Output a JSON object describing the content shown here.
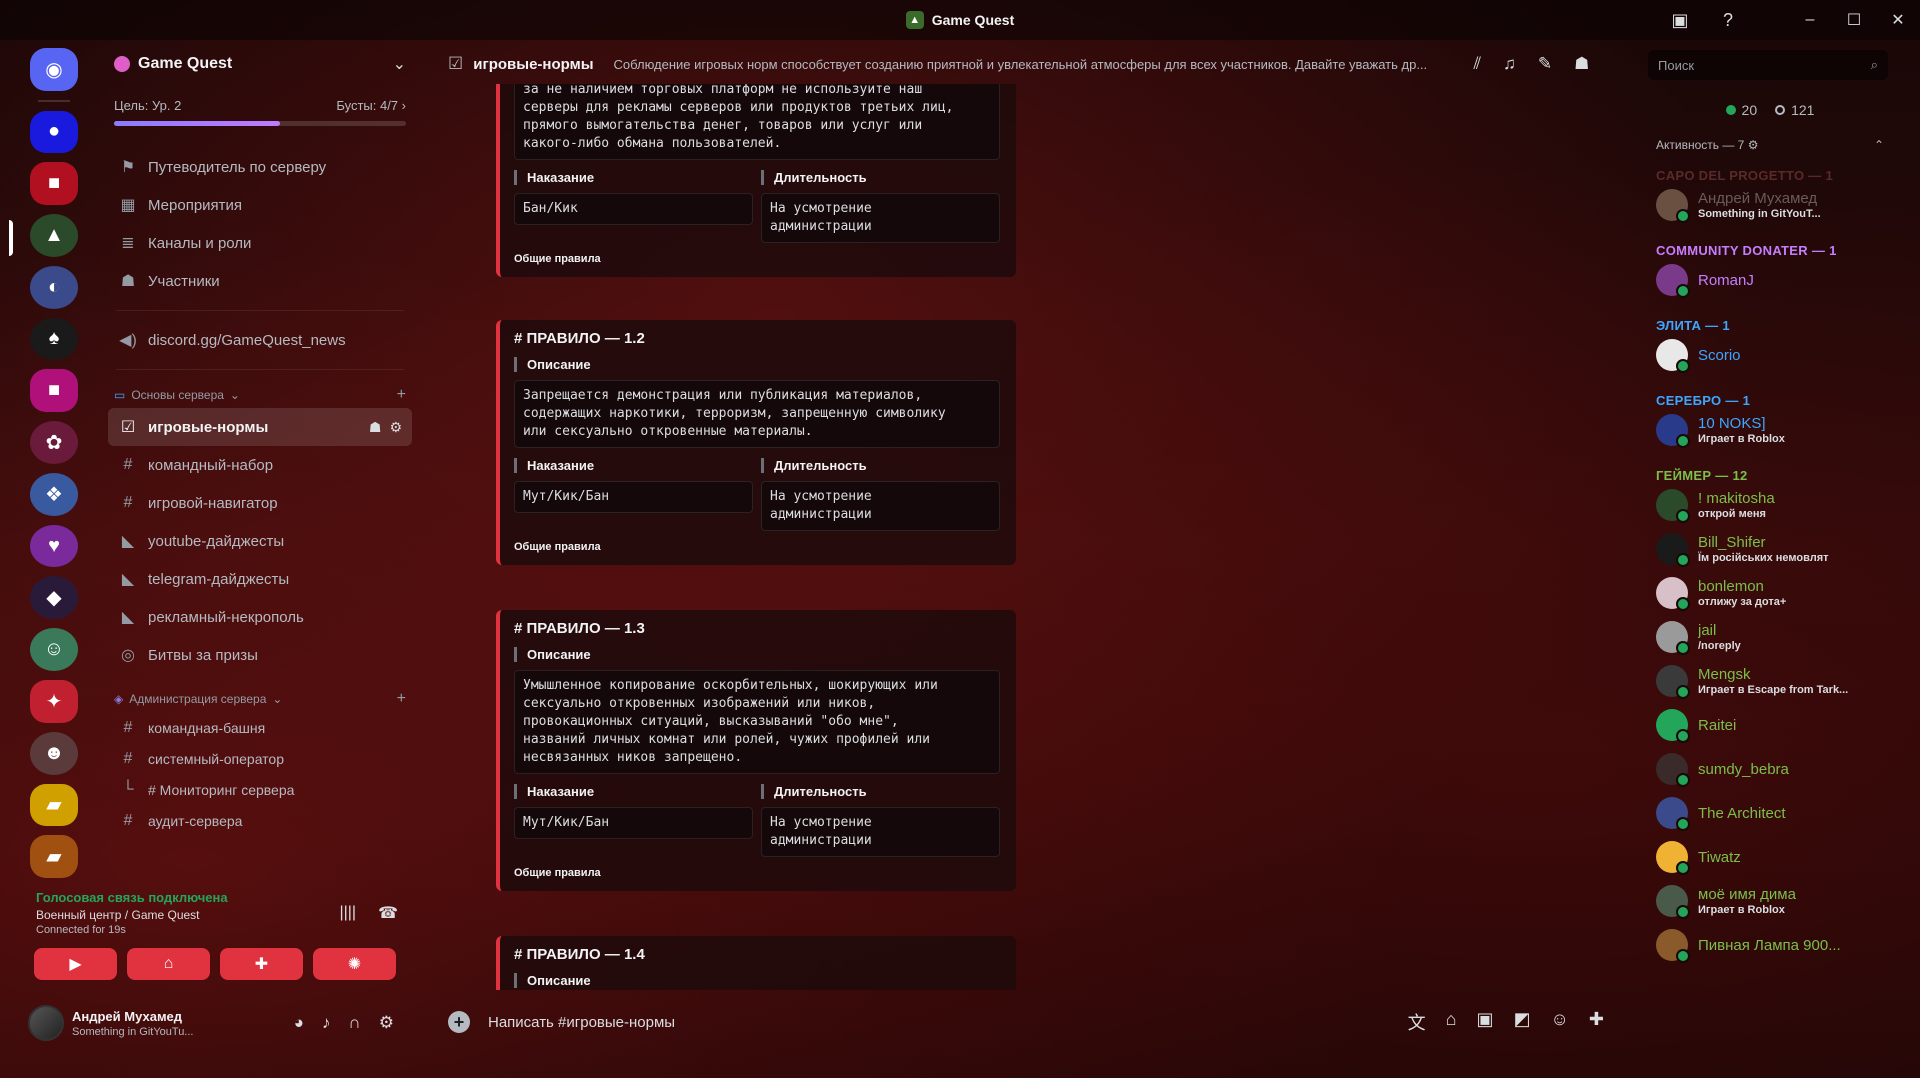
{
  "window": {
    "title": "Game Quest"
  },
  "server": {
    "name": "Game Quest",
    "boost_goal": "Цель: Ур. 2",
    "boosts": "Бусты: 4/7",
    "boost_progress": 0.57
  },
  "nav": [
    {
      "label": "Путеводитель по серверу",
      "icon": "signpost-icon"
    },
    {
      "label": "Мероприятия",
      "icon": "calendar-icon"
    },
    {
      "label": "Каналы и роли",
      "icon": "list-icon"
    },
    {
      "label": "Участники",
      "icon": "people-icon"
    }
  ],
  "stage_channel": "discord.gg/GameQuest_news",
  "category1": {
    "label": "Основы сервера",
    "channels": [
      {
        "label": "игровые-нормы",
        "active": true
      },
      {
        "label": "командный-набор"
      },
      {
        "label": "игровой-навигатор"
      },
      {
        "label": "youtube-дайджесты"
      },
      {
        "label": "telegram-дайджесты"
      },
      {
        "label": "рекламный-некрополь"
      },
      {
        "label": "Битвы за призы"
      }
    ]
  },
  "category2": {
    "label": "Администрация сервера",
    "channels": [
      {
        "label": "командная-башня"
      },
      {
        "label": "системный-оператор"
      },
      {
        "label": "# Мониторинг сервера"
      },
      {
        "label": "аудит-сервера"
      }
    ]
  },
  "voice": {
    "status": "Голосовая связь подключена",
    "location": "Военный центр / Game Quest",
    "duration": "Connected for 19s"
  },
  "user": {
    "name": "Андрей Мухамед",
    "status": "Something in GitYouTu..."
  },
  "channel_header": {
    "name": "игровые-нормы",
    "topic": "Соблюдение игровых норм способствует созданию приятной и увлекательной атмосферы для всех участников. Давайте уважать др..."
  },
  "search": {
    "placeholder": "Поиск"
  },
  "rules": {
    "partial_text": "за не наличием торговых платформ не используйте наш\nсерверы для рекламы серверов или продуктов третьих лиц,\nпрямого вымогательства денег, товаров или услуг или\nкакого-либо обмана пользователей.",
    "partial_punishment": "Бан/Кик",
    "partial_duration": "На усмотрение\nадминистрации",
    "field_description": "Описание",
    "field_punishment": "Наказание",
    "field_duration": "Длительность",
    "footer": "Общие правила",
    "items": [
      {
        "title": "# ПРАВИЛО — 1.2",
        "description": "Запрещается демонстрация или публикация материалов,\nсодержащих наркотики, терроризм, запрещенную символику\nили сексуально откровенные материалы.",
        "punishment": "Мут/Кик/Бан",
        "duration": "На усмотрение\nадминистрации"
      },
      {
        "title": "# ПРАВИЛО — 1.3",
        "description": "Умышленное копирование оскорбительных, шокирующих или\nсексуально откровенных изображений или ников,\nпровокационных ситуаций, высказываний \"обо мне\",\nназваний личных комнат или ролей, чужих профилей или\nнесвязанных ников запрещено.",
        "punishment": "Мут/Кик/Бан",
        "duration": "На усмотрение\nадминистрации"
      },
      {
        "title": "# ПРАВИЛО — 1.4"
      }
    ]
  },
  "composer": {
    "placeholder": "Написать #игровые-нормы"
  },
  "members": {
    "online": "20",
    "offline": "121",
    "activity": "Активность — 7",
    "groups": [
      {
        "role": "CAPO DEL PROGETTO — 1",
        "color": "#5a2a2a",
        "members": [
          {
            "name": "Андрей Мухамед",
            "activity": "Something in GitYouT...",
            "color": "#6b5a5a",
            "av": "#6a5040"
          }
        ]
      },
      {
        "role": "COMMUNITY DONATER — 1",
        "color": "#c77dff",
        "members": [
          {
            "name": "RomanJ",
            "activity": "",
            "color": "#c77dff",
            "av": "#7a3a8a"
          }
        ]
      },
      {
        "role": "ЭЛИТА — 1",
        "color": "#3ea6ff",
        "members": [
          {
            "name": "Scorio",
            "activity": "",
            "color": "#3ea6ff",
            "av": "#e8e8e8"
          }
        ]
      },
      {
        "role": "СЕРЕБРО — 1",
        "color": "#3ea6ff",
        "members": [
          {
            "name": "10 NOKS]",
            "activity": "Играет в Roblox",
            "color": "#3ea6ff",
            "av": "#2a3a8a"
          }
        ]
      },
      {
        "role": "ГЕЙМЕР — 12",
        "color": "#7bbf4a",
        "members": [
          {
            "name": "! makitosha",
            "activity": "открой меня",
            "color": "#7bbf4a",
            "av": "#2a4a2a"
          },
          {
            "name": "Bill_Shifer",
            "activity": "Їм російських немовлят",
            "color": "#7bbf4a",
            "av": "#1a1a1a"
          },
          {
            "name": "bonlemon",
            "activity": "отлижу за дота+",
            "color": "#7bbf4a",
            "av": "#d8c0c8"
          },
          {
            "name": "jail",
            "activity": "/noreply",
            "color": "#7bbf4a",
            "av": "#9a9a9a"
          },
          {
            "name": "Mengsk",
            "activity": "Играет в Escape from Tark...",
            "color": "#7bbf4a",
            "av": "#3a3a3a"
          },
          {
            "name": "Raitei",
            "activity": "",
            "color": "#7bbf4a",
            "av": "#23a55a"
          },
          {
            "name": "sumdy_bebra",
            "activity": "",
            "color": "#7bbf4a",
            "av": "#3a2a2a"
          },
          {
            "name": "The Architect",
            "activity": "",
            "color": "#7bbf4a",
            "av": "#3a4a8a"
          },
          {
            "name": "Tiwatz",
            "activity": "",
            "color": "#7bbf4a",
            "av": "#f0b232"
          },
          {
            "name": "моё имя дима",
            "activity": "Играет в Roblox",
            "color": "#7bbf4a",
            "av": "#4a5a4a"
          },
          {
            "name": "Пивная Лампа 900...",
            "activity": "",
            "color": "#7bbf4a",
            "av": "#8a5a2a"
          }
        ]
      }
    ]
  }
}
